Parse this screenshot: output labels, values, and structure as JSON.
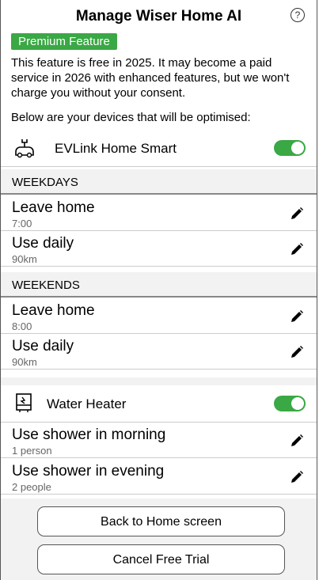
{
  "header": {
    "title": "Manage Wiser Home AI",
    "help_icon": "question-circle-icon",
    "help_glyph": "?"
  },
  "badge": {
    "label": "Premium Feature",
    "color": "#3aa845"
  },
  "intro": {
    "text": "This feature is free in 2025. It may become a paid service in 2026 with enhanced features, but we won't charge you without your consent.",
    "devices_label": "Below are your devices that will be optimised:"
  },
  "devices": [
    {
      "name": "EVLink Home Smart",
      "icon": "ev-charger-icon",
      "enabled": true,
      "sections": [
        {
          "label": "WEEKDAYS",
          "items": [
            {
              "title": "Leave home",
              "value": "7:00"
            },
            {
              "title": "Use daily",
              "value": "90km"
            }
          ]
        },
        {
          "label": "WEEKENDS",
          "items": [
            {
              "title": "Leave home",
              "value": "8:00"
            },
            {
              "title": "Use daily",
              "value": "90km"
            }
          ]
        }
      ]
    },
    {
      "name": "Water Heater",
      "icon": "water-heater-icon",
      "enabled": true,
      "items": [
        {
          "title": "Use shower in morning",
          "value": "1 person"
        },
        {
          "title": "Use shower in evening",
          "value": "2 people"
        }
      ]
    }
  ],
  "buttons": {
    "back_home": "Back to Home screen",
    "cancel_trial": "Cancel Free Trial"
  },
  "colors": {
    "accent": "#3aa845"
  }
}
